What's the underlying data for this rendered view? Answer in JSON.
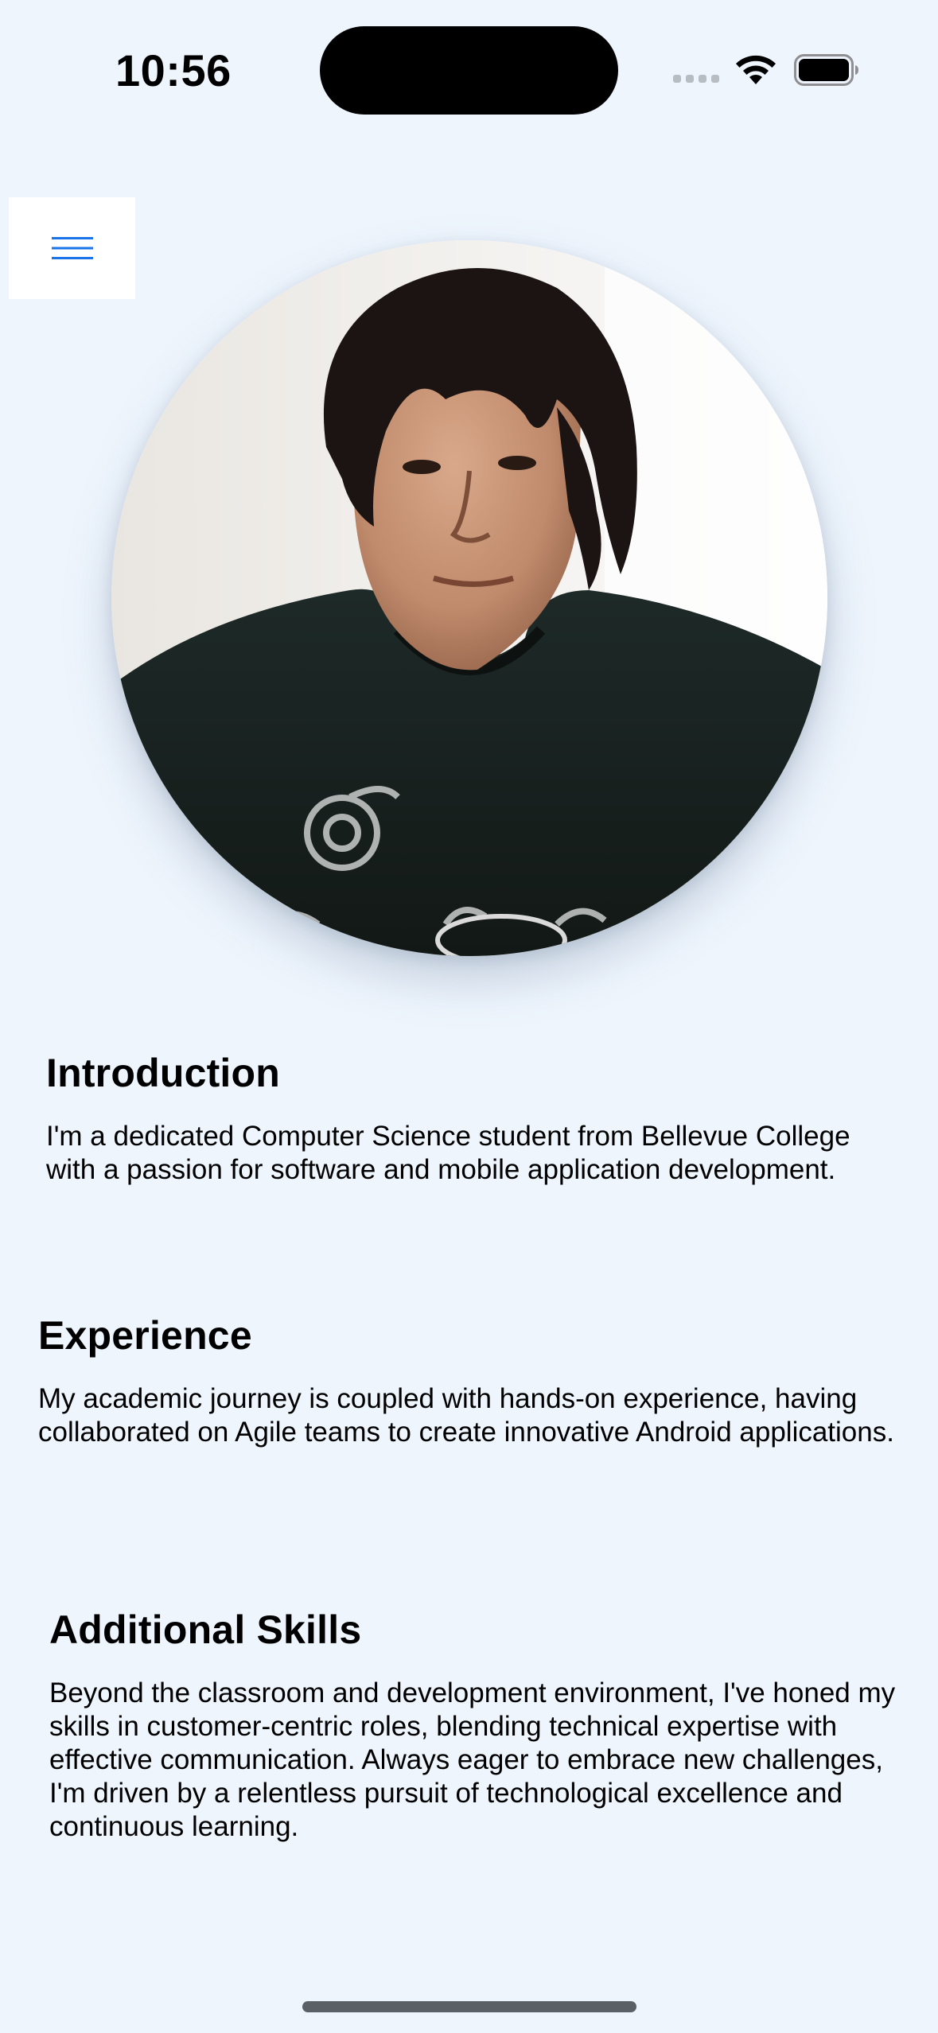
{
  "status_bar": {
    "time": "10:56"
  },
  "menu": {
    "icon": "hamburger-menu-icon",
    "accent_color": "#1A73E8"
  },
  "profile": {
    "image_description": "profile-photo"
  },
  "sections": [
    {
      "heading": "Introduction",
      "body": "I'm a dedicated Computer Science student from Bellevue College with a passion for software and mobile application development."
    },
    {
      "heading": "Experience",
      "body": "My academic journey is coupled with hands-on experience, having collaborated on Agile teams to create innovative Android applications."
    },
    {
      "heading": "Additional Skills",
      "body": "Beyond the classroom and development environment, I've honed my skills in customer-centric roles, blending technical expertise with effective communication. Always eager to embrace new challenges, I'm driven by a relentless pursuit of technological excellence and continuous learning."
    }
  ],
  "colors": {
    "background": "#EEF5FD",
    "text": "#000000"
  }
}
